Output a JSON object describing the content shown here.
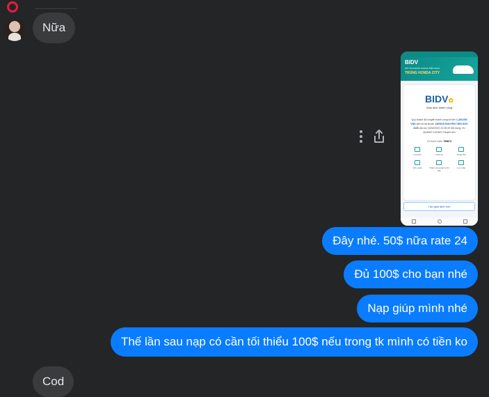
{
  "thread": {
    "incoming_top": {
      "text": "Nữa"
    },
    "incoming_bottom": {
      "text": "Cod"
    },
    "outgoing": [
      {
        "text": "Đây nhé. 50$ nữa rate 24"
      },
      {
        "text": "Đủ 100$ cho bạn nhé"
      },
      {
        "text": "Nạp giúp mình nhé"
      },
      {
        "text": "Thế lần sau nạp có cần tối thiểu 100$ nếu trong tk mình có tiền ko"
      }
    ]
  },
  "attachment": {
    "banner_logo": "BIDV",
    "banner_line1": "MỞ TÀI KHOẢN CHUNG TIỀN NGAY",
    "banner_line2": "TRÚNG HONDA CITY",
    "logo": "BIDV",
    "title": "Giao dịch thành công",
    "body_pre": "Quý khách đã chuyển thành công số tiền",
    "amount": "1,200,000 VND",
    "body_mid": "đến số tài khoản",
    "account": "1300615 NGUYEN TIEN DAT/ ACB",
    "body_post": "vào lúc 16/02/2022 22:28:43 Nội dung: VU QUANG CUONG Chuyen tien",
    "ref_label": "Số tham chiếu",
    "ref_value": "735674",
    "actions": [
      "Lưu ảnh",
      "Chia sẻ",
      "Trang chủ",
      "Gửi email",
      "Thêm vào quản lý chi tiêu",
      "Lưu mẫu"
    ],
    "button": "Tạo giao dịch mới"
  },
  "colors": {
    "outgoing": "#0a7cff",
    "incoming": "#3a3b3c",
    "background": "#242526",
    "status_ring": "#e41e3f"
  },
  "icons": {
    "more": "more-vertical-icon",
    "share": "share-icon"
  }
}
